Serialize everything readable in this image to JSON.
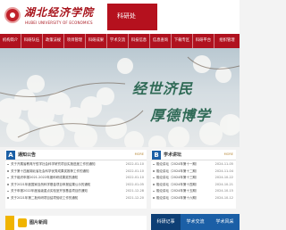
{
  "header": {
    "logo_cn": "湖北经济学院",
    "logo_en": "HUBEI UNIVERSITY OF ECONOMICS",
    "site_name": "科研处"
  },
  "nav": {
    "items": [
      "机构简介",
      "科研队伍",
      "政策法规",
      "项目管理",
      "科研成果",
      "学术交流",
      "科技信息",
      "信息查询",
      "下载专区",
      "科研平台",
      "组织管理"
    ]
  },
  "banner": {
    "slogan_line1": "经世济民",
    "slogan_line2": "厚德博学"
  },
  "notices": {
    "badge": "A",
    "title": "通知公告",
    "more": "MORE",
    "items": [
      {
        "title": "关于开展省教育厅哲学社会科学研究项目实施进度工作的通知",
        "date": "2022-01-10"
      },
      {
        "title": "关于第十四届湖北省社会科学优秀成果奖推荐工作的通知",
        "date": "2022-01-10"
      },
      {
        "title": "关于组织申报2021-2022年度科研成果奖的通知",
        "date": "2022-01-10"
      },
      {
        "title": "关于2021年度国家自然科学基金项目申报结果公示的通知",
        "date": "2022-01-05"
      },
      {
        "title": "关于申报2022年度省级重点实验室开放基金项目的通知",
        "date": "2021-12-28"
      },
      {
        "title": "关于2021年第二批科研项目结项验收工作的通知",
        "date": "2021-12-20"
      }
    ]
  },
  "lectures": {
    "badge": "B",
    "title": "学术讲坛",
    "more": "MORE",
    "items": [
      {
        "title": "融论讲坛（2024年第十一期）",
        "date": "2024-11-05"
      },
      {
        "title": "融论讲坛（2024年第十二期）",
        "date": "2024-11-04"
      },
      {
        "title": "融论讲坛（2024年第十三期）",
        "date": "2024-10-22"
      },
      {
        "title": "融论讲坛（2024年第十四期）",
        "date": "2024-10-21"
      },
      {
        "title": "融论讲坛（2024年第十五期）",
        "date": "2024-10-15"
      },
      {
        "title": "融论讲坛（2024年第十六期）",
        "date": "2024-10-12"
      }
    ]
  },
  "bottom": {
    "left_label": "图片新闻",
    "tabs": [
      "科研记事",
      "学术交流",
      "学术风采"
    ]
  },
  "colors": {
    "brand_red": "#b0121f",
    "accent_blue": "#1b5fa6",
    "accent_gold": "#f0b400"
  }
}
